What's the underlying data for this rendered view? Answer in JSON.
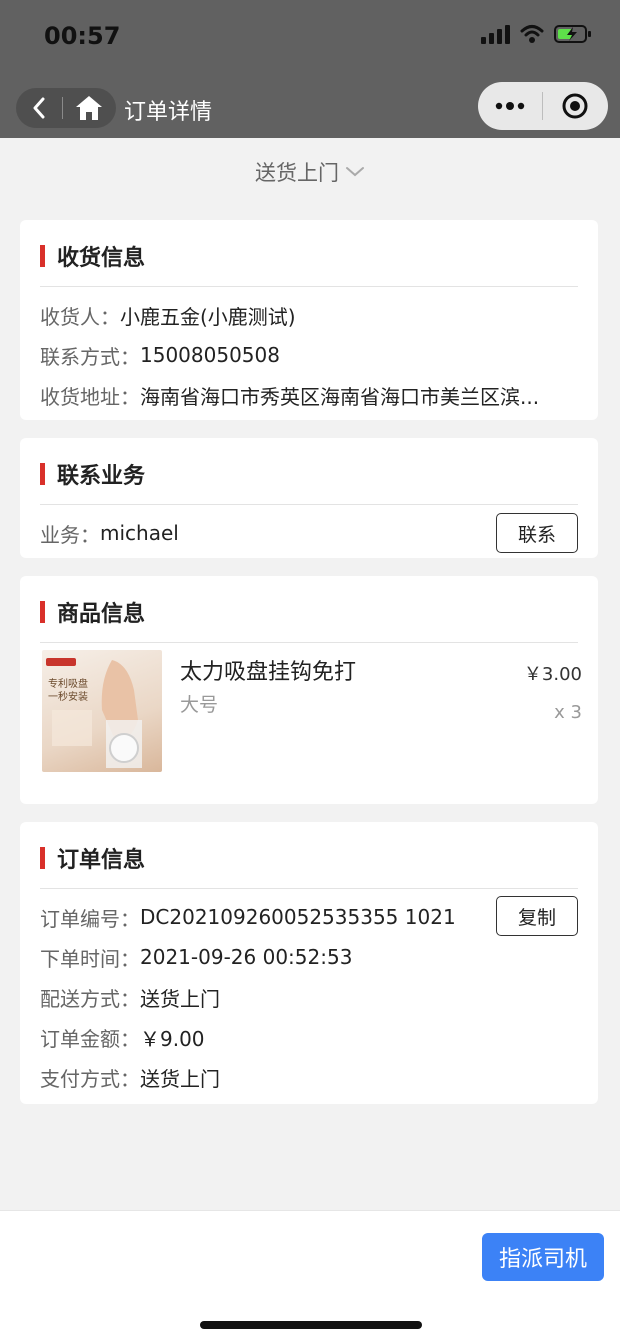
{
  "status": {
    "time": "00:57"
  },
  "navbar": {
    "title": "订单详情"
  },
  "delivery_selector": {
    "label": "送货上门"
  },
  "receiver_section": {
    "title": "收货信息",
    "receiver_label": "收货人：",
    "receiver_value": "小鹿五金(小鹿测试)",
    "contact_label": "联系方式：",
    "contact_value": "15008050508",
    "address_label": "收货地址：",
    "address_value": "海南省海口市秀英区海南省海口市美兰区滨..."
  },
  "sales_section": {
    "title": "联系业务",
    "sales_label": "业务：",
    "sales_value": "michael",
    "contact_button": "联系"
  },
  "product_section": {
    "title": "商品信息",
    "product": {
      "name": "太力吸盘挂钩免打",
      "spec": "大号",
      "price": "￥3.00",
      "quantity": "x 3",
      "image_caption": "专利吸盘\n一秒安装"
    }
  },
  "order_section": {
    "title": "订单信息",
    "order_no_label": "订单编号：",
    "order_no_value": "DC202109260052535355 1021",
    "copy_button": "复制",
    "order_time_label": "下单时间：",
    "order_time_value": "2021-09-26 00:52:53",
    "delivery_label": "配送方式：",
    "delivery_value": "送货上门",
    "amount_label": "订单金额：",
    "amount_value": "￥9.00",
    "payment_label": "支付方式：",
    "payment_value": "送货上门"
  },
  "footer": {
    "assign_button": "指派司机"
  },
  "colors": {
    "accent_red": "#d9302a",
    "primary_blue": "#3c82f6",
    "nav_gray": "#616161"
  }
}
